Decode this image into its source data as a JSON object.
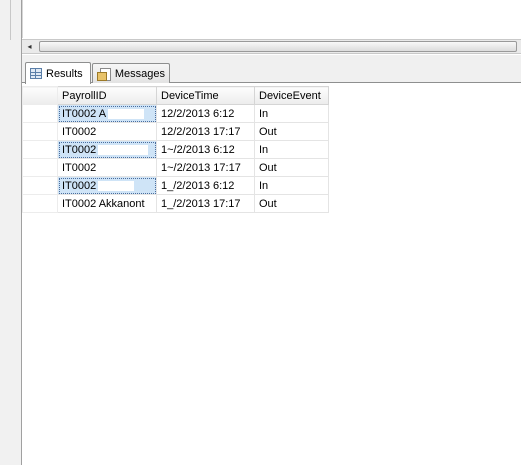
{
  "tabs": [
    {
      "label": "Results",
      "icon": "grid-icon",
      "active": true
    },
    {
      "label": "Messages",
      "icon": "messages-icon",
      "active": false
    }
  ],
  "scrollbar": {
    "left_arrow": "◂"
  },
  "grid": {
    "columns": [
      "PayrollID",
      "DeviceTime",
      "DeviceEvent"
    ],
    "rows": [
      {
        "payroll": "IT0002 A",
        "time": "12/2/2013 6:12",
        "event": "In",
        "selected": true
      },
      {
        "payroll": "IT0002",
        "time": "12/2/2013 17:17",
        "event": "Out",
        "selected": false
      },
      {
        "payroll": "IT0002",
        "time": "1~/2/2013 6:12",
        "event": "In",
        "selected": true
      },
      {
        "payroll": "IT0002",
        "time": "1~/2/2013 17:17",
        "event": "Out",
        "selected": false
      },
      {
        "payroll": "IT0002",
        "time": "1_/2/2013 6:12",
        "event": "In",
        "selected": true
      },
      {
        "payroll": "IT0002 Akkanont",
        "time": "1_/2/2013 17:17",
        "event": "Out",
        "selected": false
      }
    ]
  }
}
